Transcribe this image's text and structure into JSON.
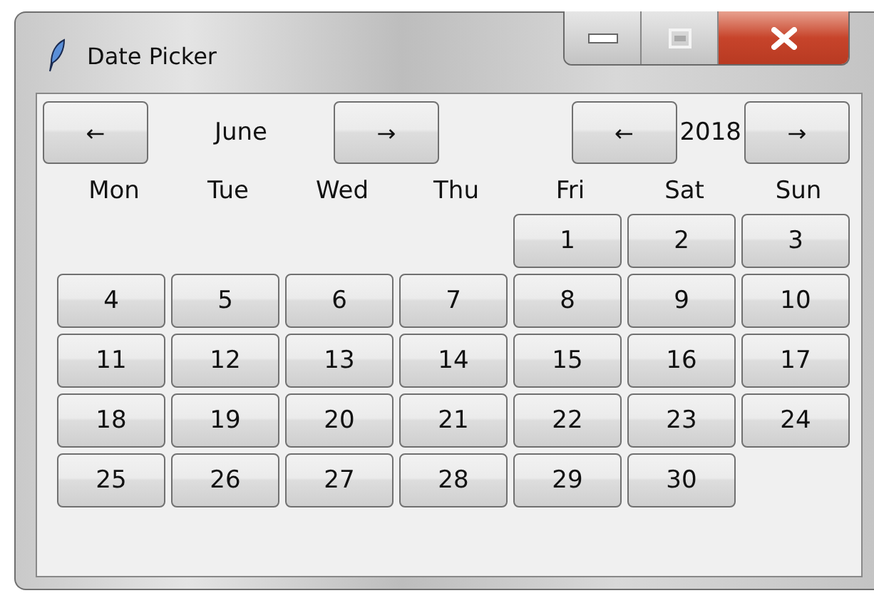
{
  "window": {
    "title": "Date Picker"
  },
  "month_nav": {
    "prev": "←",
    "label": "June",
    "next": "→"
  },
  "year_nav": {
    "prev": "←",
    "label": "2018",
    "next": "→"
  },
  "weekdays": [
    "Mon",
    "Tue",
    "Wed",
    "Thu",
    "Fri",
    "Sat",
    "Sun"
  ],
  "weeks": [
    [
      "1",
      "2",
      "3"
    ],
    [
      "4",
      "5",
      "6",
      "7",
      "8",
      "9",
      "10"
    ],
    [
      "11",
      "12",
      "13",
      "14",
      "15",
      "16",
      "17"
    ],
    [
      "18",
      "19",
      "20",
      "21",
      "22",
      "23",
      "24"
    ],
    [
      "25",
      "26",
      "27",
      "28",
      "29",
      "30"
    ]
  ]
}
